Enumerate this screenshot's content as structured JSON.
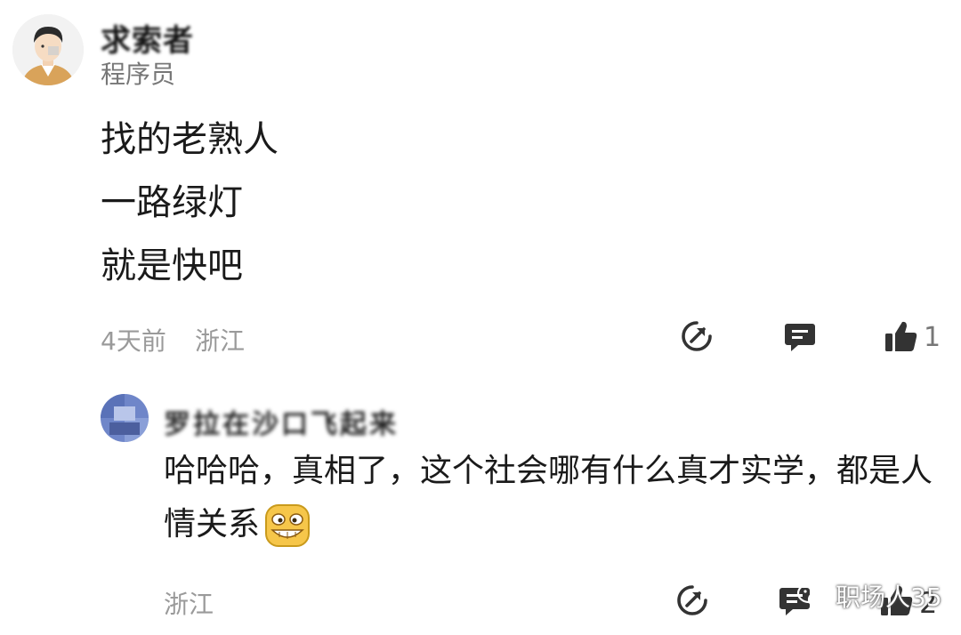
{
  "comment": {
    "username": "求索者",
    "title": "程序员",
    "lines": [
      "找的老熟人",
      "一路绿灯",
      "就是快吧"
    ],
    "time": "4天前",
    "location": "浙江",
    "like_count": "1",
    "icons": {
      "share": "share-icon",
      "reply": "comment-icon",
      "like": "thumbs-up-icon"
    }
  },
  "reply": {
    "username": "罗拉在沙口飞起来",
    "text": "哈哈哈，真相了，这个社会哪有什么真才实学，都是人情关系",
    "location": "浙江",
    "like_count": "2",
    "emoji": "grin-emoji"
  },
  "watermark": {
    "text": "职场人35",
    "icon": "wechat-icon"
  },
  "colors": {
    "text": "#1a1a1a",
    "meta": "#9a9a9a",
    "icon": "#333333"
  }
}
